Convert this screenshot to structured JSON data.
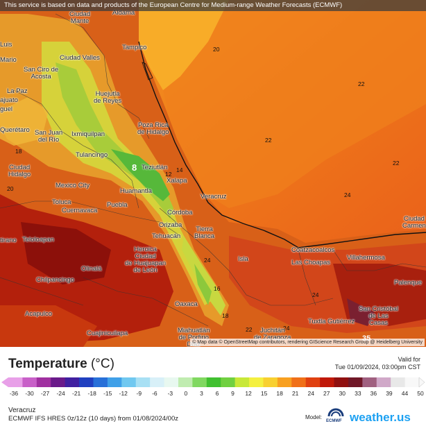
{
  "banner": "This service is based on data and products of the European Centre for Medium-range Weather Forecasts (ECMWF)",
  "attribution": "© Map data © OpenStreetMap contributors, rendering GIScience Research Group @ Heidelberg University",
  "cities": {
    "ciudad_mante": "Ciudad\nMante",
    "aldama": "Aldama",
    "tampico": "Tampico",
    "ciudad_valles": "Ciudad Valles",
    "san_ciro": "San Ciro de\nAcosta",
    "huejutla": "Huejutla\nde Reyes",
    "poza_rica": "Poza Rica\nde Hidalgo",
    "queretaro": "Querétaro",
    "san_juan_rio": "San Juan\ndel Río",
    "ixmiquilpan": "Ixmiquilpan",
    "tulancingo": "Tulancingo",
    "teziutlan": "Teziutlán",
    "xalapa": "Xalapa",
    "ciudad_hidalgo": "Ciudad\nHidalgo",
    "mexico_city": "Mexico City",
    "huamantla": "Huamantla",
    "veracruz": "Veracruz",
    "toluca": "Toluca",
    "cuernavaca": "Cuernavaca",
    "puebla": "Puebla",
    "cordoba": "Córdoba",
    "orizaba": "Orizaba",
    "tierra_blanca": "Tierra\nBlanca",
    "tehuacan": "Tehuacán",
    "teloloapan": "Teloloapan",
    "heroica": "Heroica\nCiudad\nde Huajuapan\nde León",
    "iguala": "Iguala",
    "coatzacoalcos": "Coatzacoalcos",
    "las_choapas": "Las Choapas",
    "villahermosa": "Villahermosa",
    "ciudad_carmen": "Ciudad\nCarmen",
    "isla": "Isla",
    "chilpancingo": "Chilpancingo",
    "palenque": "Palenque",
    "oaxaca": "Oaxaca",
    "acapulco": "Acapulco",
    "san_cristobal": "San Cristóbal\nde Las\nCasas",
    "tuxtla": "Tuxtla Gutiérrez",
    "cuajinicuilapa": "Cuajinicuilapa",
    "miahuatlan": "Miahuatlán\nde Porfirio\nDíaz",
    "juchitan": "Juchitán\nde Zaragoza",
    "luis": "Luis",
    "mario": "Mario",
    "la_paz": "La Paz",
    "anajuato": "ajuato",
    "guel": "guel",
    "olinala": "Olinalá",
    "tirano": "tirano",
    "ria": "ria",
    "ela": "ela"
  },
  "contour_labels": [
    "20",
    "22",
    "22",
    "22",
    "24",
    "24",
    "24",
    "24",
    "22",
    "18",
    "16",
    "14",
    "12",
    "8",
    "35",
    "20",
    "18"
  ],
  "legend": {
    "title": "Temperature",
    "unit": "(°C)",
    "valid_label": "Valid for",
    "valid_time": "Tue 01/09/2024, 03:00pm CST",
    "ticks": [
      "-36",
      "-30",
      "-27",
      "-24",
      "-21",
      "-18",
      "-15",
      "-12",
      "-9",
      "-6",
      "-3",
      "0",
      "3",
      "6",
      "9",
      "12",
      "15",
      "18",
      "21",
      "24",
      "27",
      "30",
      "33",
      "36",
      "39",
      "44",
      "50"
    ],
    "colors": [
      "#e8a0e8",
      "#c860c8",
      "#a030a0",
      "#6a1a8a",
      "#4020a0",
      "#2040c0",
      "#2870d8",
      "#40a0e8",
      "#70c8f0",
      "#a8e0f4",
      "#d8f0f8",
      "#e8f8f0",
      "#c0ecb0",
      "#80d860",
      "#40c030",
      "#70d040",
      "#c8e838",
      "#f4f040",
      "#f8d030",
      "#f8a020",
      "#f07018",
      "#e04010",
      "#c01808",
      "#901010",
      "#701828",
      "#a06080",
      "#d0a8c8",
      "#e8e8e8",
      "#f8f8f8"
    ]
  },
  "footer": {
    "region": "Veracruz",
    "model": "ECMWF IFS HRES 0z/12z (10 days) from 01/08/2024/00z",
    "model_label": "Model:",
    "ecmwf": "ECMWF",
    "brand": "weather.us"
  }
}
